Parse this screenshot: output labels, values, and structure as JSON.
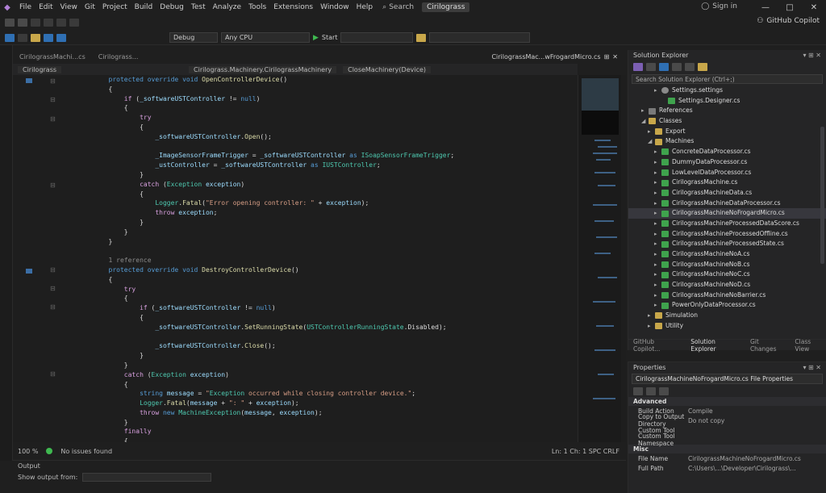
{
  "menubar": {
    "items": [
      "File",
      "Edit",
      "View",
      "Git",
      "Project",
      "Build",
      "Debug",
      "Test",
      "Analyze",
      "Tools",
      "Extensions",
      "Window",
      "Help"
    ],
    "search": "Search",
    "project": "Cirilograss",
    "signin": "Sign in",
    "win_min": "—",
    "win_max": "□",
    "win_close": "✕"
  },
  "toolbar": {
    "config": "Debug",
    "platform": "Any CPU",
    "start": "Start",
    "copilot": "GitHub Copilot"
  },
  "editor": {
    "tabs": [
      "CirilograssMachi...cs",
      "Cirilograss..."
    ],
    "active_tab_right": "CirilograssMac...wFrogardMicro.cs",
    "nav_project": "Cirilograss",
    "nav_class": "Cirilograss.Machinery.CirilograssMachinery",
    "nav_member": "CloseMachinery(Device)",
    "zoom": "100 %",
    "issues": "No issues found",
    "line_info": "Ln: 1  Ch: 1  SPC  CRLF"
  },
  "output": {
    "title": "Output",
    "show_from": "Show output from:"
  },
  "solution": {
    "title": "Solution Explorer",
    "search": "Search Solution Explorer (Ctrl+;)",
    "items": [
      {
        "label": "Settings.settings",
        "icon": "cfg",
        "indent": 4,
        "arrow": "▸"
      },
      {
        "label": "Settings.Designer.cs",
        "icon": "cs",
        "indent": 5,
        "arrow": ""
      },
      {
        "label": "References",
        "icon": "ref",
        "indent": 2,
        "arrow": "▸"
      },
      {
        "label": "Classes",
        "icon": "folder",
        "indent": 2,
        "arrow": "◢"
      },
      {
        "label": "Export",
        "icon": "folder",
        "indent": 3,
        "arrow": "▸"
      },
      {
        "label": "Machines",
        "icon": "folder",
        "indent": 3,
        "arrow": "◢"
      },
      {
        "label": "ConcreteDataProcessor.cs",
        "icon": "cs",
        "indent": 4,
        "arrow": "▸"
      },
      {
        "label": "DummyDataProcessor.cs",
        "icon": "cs",
        "indent": 4,
        "arrow": "▸"
      },
      {
        "label": "LowLevelDataProcessor.cs",
        "icon": "cs",
        "indent": 4,
        "arrow": "▸"
      },
      {
        "label": "CirilograssMachine.cs",
        "icon": "cs",
        "indent": 4,
        "arrow": "▸"
      },
      {
        "label": "CirilograssMachineData.cs",
        "icon": "cs",
        "indent": 4,
        "arrow": "▸"
      },
      {
        "label": "CirilograssMachineDataProcessor.cs",
        "icon": "cs",
        "indent": 4,
        "arrow": "▸"
      },
      {
        "label": "CirilograssMachineNoFrogardMicro.cs",
        "icon": "cs",
        "indent": 4,
        "arrow": "▸",
        "selected": true
      },
      {
        "label": "CirilograssMachineProcessedDataScore.cs",
        "icon": "cs",
        "indent": 4,
        "arrow": "▸"
      },
      {
        "label": "CirilograssMachineProcessedOffline.cs",
        "icon": "cs",
        "indent": 4,
        "arrow": "▸"
      },
      {
        "label": "CirilograssMachineProcessedState.cs",
        "icon": "cs",
        "indent": 4,
        "arrow": "▸"
      },
      {
        "label": "CirilograssMachineNoA.cs",
        "icon": "cs",
        "indent": 4,
        "arrow": "▸"
      },
      {
        "label": "CirilograssMachineNoB.cs",
        "icon": "cs",
        "indent": 4,
        "arrow": "▸"
      },
      {
        "label": "CirilograssMachineNoC.cs",
        "icon": "cs",
        "indent": 4,
        "arrow": "▸"
      },
      {
        "label": "CirilograssMachineNoD.cs",
        "icon": "cs",
        "indent": 4,
        "arrow": "▸"
      },
      {
        "label": "CirilograssMachineNoBarrier.cs",
        "icon": "cs",
        "indent": 4,
        "arrow": "▸"
      },
      {
        "label": "PowerOnlyDataProcessor.cs",
        "icon": "cs",
        "indent": 4,
        "arrow": "▸"
      },
      {
        "label": "Simulation",
        "icon": "folder",
        "indent": 3,
        "arrow": "▸"
      },
      {
        "label": "Utility",
        "icon": "folder",
        "indent": 3,
        "arrow": "▸"
      }
    ],
    "bottom_tabs": [
      "GitHub Copilot...",
      "Solution Explorer",
      "Git Changes",
      "Class View"
    ]
  },
  "properties": {
    "title": "Properties",
    "object": "CirilograssMachineNoFrogardMicro.cs  File Properties",
    "advanced": "Advanced",
    "advanced_rows": [
      {
        "k": "Build Action",
        "v": "Compile"
      },
      {
        "k": "Copy to Output Directory",
        "v": "Do not copy"
      },
      {
        "k": "Custom Tool",
        "v": ""
      },
      {
        "k": "Custom Tool Namespace",
        "v": ""
      }
    ],
    "misc": "Misc",
    "misc_rows": [
      {
        "k": "File Name",
        "v": "CirilograssMachineNoFrogardMicro.cs"
      },
      {
        "k": "Full Path",
        "v": "C:\\Users\\...\\Developer\\Cirilograss\\..."
      }
    ]
  },
  "code_lines": [
    {
      "t": "        protected override void OpenControllerDevice()",
      "c": "sig"
    },
    {
      "t": "        {",
      "c": ""
    },
    {
      "t": "            if (_softwareUSTController != null)",
      "c": "if"
    },
    {
      "t": "            {",
      "c": ""
    },
    {
      "t": "                try",
      "c": "kw2"
    },
    {
      "t": "                {",
      "c": ""
    },
    {
      "t": "                    _softwareUSTController.Open();",
      "c": "call"
    },
    {
      "t": "",
      "c": ""
    },
    {
      "t": "                    _ImageSensorFrameTrigger = _softwareUSTController as ISoapSensorFrameTrigger;",
      "c": "call"
    },
    {
      "t": "                    _ustController = _softwareUSTController as IUSTController;",
      "c": "call"
    },
    {
      "t": "                }",
      "c": ""
    },
    {
      "t": "                catch (Exception exception)",
      "c": "catch"
    },
    {
      "t": "                {",
      "c": ""
    },
    {
      "t": "                    Logger.Fatal(\"Error opening controller: \" + exception);",
      "c": "str"
    },
    {
      "t": "                    throw exception;",
      "c": "kw2"
    },
    {
      "t": "                }",
      "c": ""
    },
    {
      "t": "            }",
      "c": ""
    },
    {
      "t": "        }",
      "c": ""
    },
    {
      "t": "",
      "c": ""
    },
    {
      "t": "        1 reference",
      "c": "cm"
    },
    {
      "t": "        protected override void DestroyControllerDevice()",
      "c": "sig"
    },
    {
      "t": "        {",
      "c": ""
    },
    {
      "t": "            try",
      "c": "kw2"
    },
    {
      "t": "            {",
      "c": ""
    },
    {
      "t": "                if (_softwareUSTController != null)",
      "c": "if"
    },
    {
      "t": "                {",
      "c": ""
    },
    {
      "t": "                    _softwareUSTController.SetRunningState(USTControllerRunningState.Disabled);",
      "c": "call"
    },
    {
      "t": "",
      "c": ""
    },
    {
      "t": "                    _softwareUSTController.Close();",
      "c": "call"
    },
    {
      "t": "                }",
      "c": ""
    },
    {
      "t": "            }",
      "c": ""
    },
    {
      "t": "            catch (Exception exception)",
      "c": "catch"
    },
    {
      "t": "            {",
      "c": ""
    },
    {
      "t": "                string message = \"Exception occurred while closing controller device.\";",
      "c": "str"
    },
    {
      "t": "                Logger.Fatal(message + \": \" + exception);",
      "c": "str"
    },
    {
      "t": "                throw new MachineException(message, exception);",
      "c": "kw2"
    },
    {
      "t": "            }",
      "c": ""
    },
    {
      "t": "            finally",
      "c": "kw2"
    },
    {
      "t": "            {",
      "c": ""
    }
  ]
}
